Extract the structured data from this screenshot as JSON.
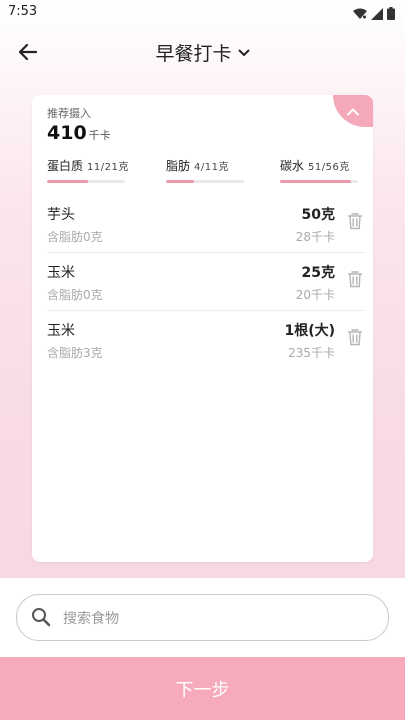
{
  "status_bar": {
    "time": "7:53"
  },
  "header": {
    "title": "早餐打卡"
  },
  "recommended": {
    "label": "推荐摄入",
    "value": "410",
    "unit": "千卡",
    "macros": [
      {
        "name": "蛋白质",
        "value": "11/21克",
        "progress": 0.52
      },
      {
        "name": "脂肪",
        "value": "4/11克",
        "progress": 0.36
      },
      {
        "name": "碳水",
        "value": "51/56克",
        "progress": 0.91
      }
    ]
  },
  "foods": [
    {
      "name": "芋头",
      "fat": "含脂肪0克",
      "qty": "50克",
      "kcal": "28千卡"
    },
    {
      "name": "玉米",
      "fat": "含脂肪0克",
      "qty": "25克",
      "kcal": "20千卡"
    },
    {
      "name": "玉米",
      "fat": "含脂肪3克",
      "qty": "1根(大)",
      "kcal": "235千卡"
    }
  ],
  "search": {
    "placeholder": "搜索食物"
  },
  "next_button": {
    "label": "下一步"
  },
  "colors": {
    "accent": "#f6aabb",
    "bar_fill": "#ef97ad"
  }
}
